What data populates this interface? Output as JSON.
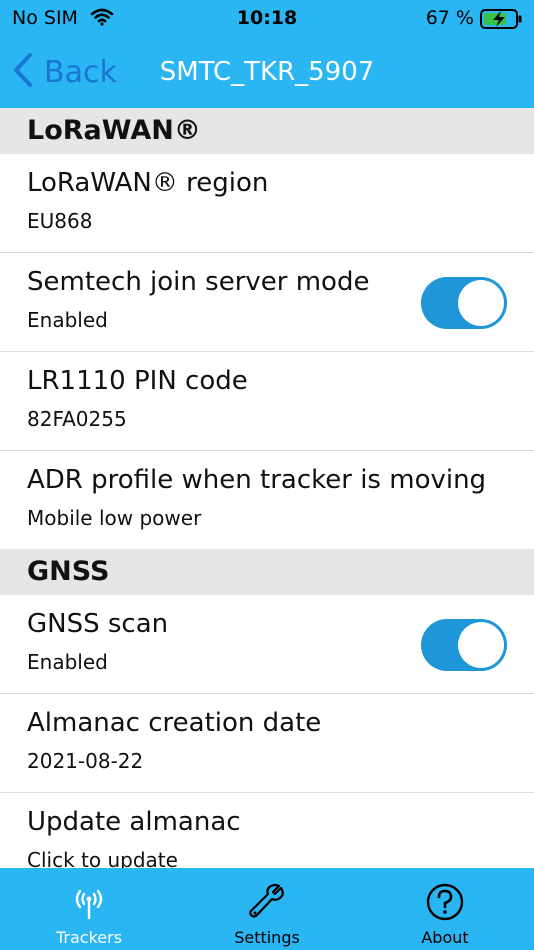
{
  "status_bar": {
    "carrier": "No SIM",
    "time": "10:18",
    "battery": "67 %",
    "icons": [
      "wifi-icon",
      "battery-charging-icon"
    ]
  },
  "nav": {
    "back_label": "Back",
    "title": "SMTC_TKR_5907",
    "back_color": "#1976d2",
    "bar_color": "#29b6f2"
  },
  "sections": [
    {
      "header": "LoRaWAN®",
      "rows": [
        {
          "title": "LoRaWAN® region",
          "value": "EU868"
        },
        {
          "title": "Semtech join server mode",
          "value": "Enabled",
          "toggle": true
        },
        {
          "title": "LR1110 PIN code",
          "value": "82FA0255"
        },
        {
          "title": "ADR profile when tracker is moving",
          "value": "Mobile low power"
        }
      ]
    },
    {
      "header": "GNSS",
      "rows": [
        {
          "title": "GNSS scan",
          "value": "Enabled",
          "toggle": true
        },
        {
          "title": "Almanac creation date",
          "value": "2021-08-22"
        },
        {
          "title": "Update almanac",
          "value": "Click to update"
        }
      ]
    }
  ],
  "tabs": [
    {
      "label": "Trackers",
      "icon": "antenna-icon",
      "active": true
    },
    {
      "label": "Settings",
      "icon": "wrench-icon",
      "active": false
    },
    {
      "label": "About",
      "icon": "question-circle-icon",
      "active": false
    }
  ]
}
